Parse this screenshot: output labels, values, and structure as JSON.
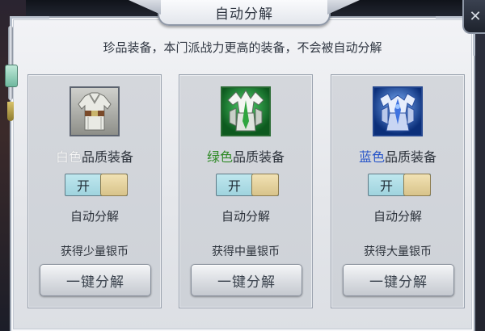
{
  "dialog": {
    "title": "自动分解",
    "close_glyph": "✕",
    "subtitle": "珍品装备，本门派战力更高的装备，不会被自动分解"
  },
  "cards": [
    {
      "quality": "白色",
      "quality_suffix": "品质装备",
      "quality_color": "#f7f7f7",
      "icon": "white-robe-armor-icon",
      "toggle_label": "开",
      "toggle_on": true,
      "auto_label": "自动分解",
      "reward_text": "获得少量银币",
      "button_label": "一键分解"
    },
    {
      "quality": "绿色",
      "quality_suffix": "品质装备",
      "quality_color": "#2f8a26",
      "icon": "green-feather-armor-icon",
      "toggle_label": "开",
      "toggle_on": true,
      "auto_label": "自动分解",
      "reward_text": "获得中量银币",
      "button_label": "一键分解"
    },
    {
      "quality": "蓝色",
      "quality_suffix": "品质装备",
      "quality_color": "#2855c8",
      "icon": "blue-crystal-armor-icon",
      "toggle_label": "开",
      "toggle_on": true,
      "auto_label": "自动分解",
      "reward_text": "获得大量银币",
      "button_label": "一键分解"
    }
  ]
}
